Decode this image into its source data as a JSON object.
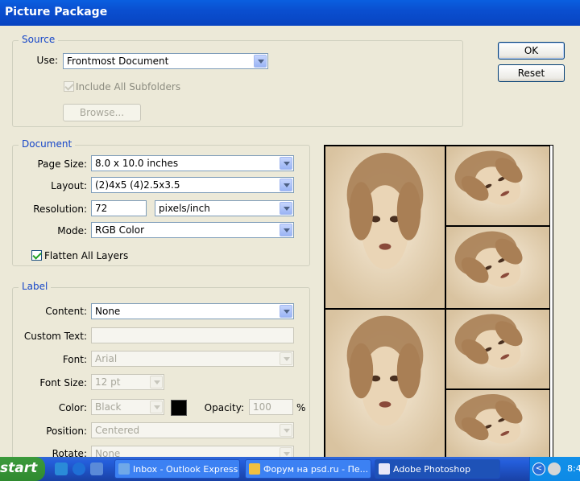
{
  "window": {
    "title": "Picture Package"
  },
  "buttons": {
    "ok": "OK",
    "reset": "Reset"
  },
  "source": {
    "legend": "Source",
    "use_label": "Use:",
    "use_value": "Frontmost Document",
    "include_subfolders": "Include All Subfolders",
    "include_checked": true,
    "browse": "Browse..."
  },
  "document": {
    "legend": "Document",
    "page_size_label": "Page Size:",
    "page_size": "8.0 x 10.0 inches",
    "layout_label": "Layout:",
    "layout": "(2)4x5 (4)2.5x3.5",
    "resolution_label": "Resolution:",
    "resolution": "72",
    "resolution_unit": "pixels/inch",
    "mode_label": "Mode:",
    "mode": "RGB Color",
    "flatten": "Flatten All Layers",
    "flatten_checked": true
  },
  "label": {
    "legend": "Label",
    "content_label": "Content:",
    "content": "None",
    "custom_text_label": "Custom Text:",
    "custom_text": "",
    "font_label": "Font:",
    "font": "Arial",
    "font_size_label": "Font Size:",
    "font_size": "12 pt",
    "color_label": "Color:",
    "color": "Black",
    "swatch_color": "#000000",
    "opacity_label": "Opacity:",
    "opacity": "100",
    "opacity_unit": "%",
    "position_label": "Position:",
    "position": "Centered",
    "rotate_label": "Rotate:",
    "rotate": "None"
  },
  "preview": {
    "photo_tone": "#a97f55"
  },
  "taskbar": {
    "start": "start",
    "tasks": [
      "Inbox - Outlook Express",
      "Форум на psd.ru - Пе...",
      "Adobe Photoshop"
    ],
    "clock": "8:4"
  }
}
